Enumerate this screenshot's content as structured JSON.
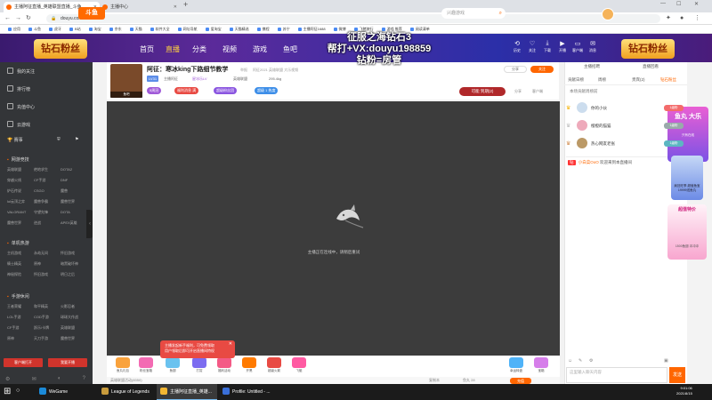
{
  "browser": {
    "tabs": [
      {
        "label": "主播阿征直播_英雄联盟直播_斗鱼..."
      },
      {
        "label": "主播中心"
      }
    ],
    "url": "douyu.com/198859",
    "bookmarks": [
      "应用",
      "斗鱼",
      "虎牙",
      "B站",
      "淘宝",
      "京东",
      "天猫",
      "软件大全",
      "网址导航",
      "爱淘宝",
      "天猫精选",
      "携程",
      "苏宁",
      "主播阿征1688",
      "微博",
      "飞猪旅行",
      "游戏 推荐",
      "阅读清单"
    ]
  },
  "header": {
    "left_badge": "钻石粉丝",
    "logo": "斗鱼",
    "nav": [
      "首页",
      "直播",
      "分类",
      "视频",
      "游戏",
      "鱼吧"
    ],
    "active_nav": "直播",
    "search_placeholder": "兴趣游戏",
    "icons": [
      {
        "name": "history-icon",
        "label": "历史"
      },
      {
        "name": "follow-icon",
        "label": "关注"
      },
      {
        "name": "download-icon",
        "label": "下载"
      },
      {
        "name": "live-icon",
        "label": "开播"
      },
      {
        "name": "client-icon",
        "label": "客户端"
      },
      {
        "name": "message-icon",
        "label": "消息"
      }
    ],
    "right_badge": "钻石粉丝"
  },
  "overlay": {
    "line1": "征服之海钻石3",
    "line2": "帮打+VX:douyu198859",
    "line3": "钻粉=房管"
  },
  "sidebar": {
    "nav": [
      "我的关注",
      "排行榜",
      "充值中心",
      "云游戏"
    ],
    "icons_label": "赛事",
    "sections": [
      {
        "title": "网游竞技",
        "items": [
          "英雄联盟",
          "绝地求生",
          "DOTA2",
          "穿越火线",
          "CF手游",
          "DNF",
          "炉石传说",
          "CSGO",
          "魔兽",
          "lol云顶之弈",
          "魔兽争霸",
          "魔兽世界",
          "VALORANT",
          "守望先锋",
          "DOTA",
          "魔兽世界",
          "逆战",
          "APEX英雄"
        ]
      },
      {
        "title": "单机热游",
        "items": [
          "主机游戏",
          "永劫无间",
          "怀旧游戏",
          "騎士精英",
          "原神",
          "暗黑破坏神",
          "神秘探险",
          "怀旧游戏",
          "明日之后"
        ]
      },
      {
        "title": "手游休闲",
        "items": [
          "王者荣耀",
          "和平精英",
          "火影忍者",
          "LOL手游",
          "COD手游",
          "球球大作战",
          "CF手游",
          "跃乐/卡牌",
          "英雄联盟",
          "原神",
          "天刀手游",
          "魔兽世界"
        ]
      }
    ],
    "btn_open": "客户端打开",
    "btn_live": "我要开播"
  },
  "room": {
    "avatar_label": "鱼吧",
    "title": "阿征：寒冰king下路细节教学",
    "category": "英雄联盟",
    "meta": [
      "举报",
      "阿征2021 英雄联盟 大乐视频"
    ],
    "level": "LV31",
    "line2_items": [
      "主播阿征",
      "星冰乐LV",
      "英雄联盟",
      "295.4kg"
    ],
    "pills": [
      {
        "label": "5周冠",
        "color": "#a05ad8"
      },
      {
        "label": "福利消息 满",
        "color": "#e84a43"
      },
      {
        "label": "超级粉丝团",
        "color": "#8a55e0"
      },
      {
        "label": "超级 1 热度",
        "color": "#3d8ee8"
      }
    ],
    "share_label": "分享",
    "follow_label": "关注",
    "gift_badge": "可能 到期(2)",
    "tools": [
      "分享",
      "客户端"
    ]
  },
  "player": {
    "message": "主播正在连线中，请稍后重试"
  },
  "gifts": [
    {
      "label": "鱼丸礼包",
      "color": "#f9a23c"
    },
    {
      "label": "粉丝宝箱",
      "color": "#f36bb3"
    },
    {
      "label": "鱼翅",
      "color": "#6ac2ef"
    },
    {
      "label": "打赏",
      "color": "#7c6cf0"
    },
    {
      "label": "福利活动",
      "color": "#f45a86"
    },
    {
      "label": "开黑",
      "color": "#ff7a00"
    },
    {
      "label": "超级火箭",
      "color": "#e84a43"
    },
    {
      "label": "飞艇",
      "color": "#ff5aa2"
    },
    {
      "label": "幸运转盘",
      "color": "#4fb3f8"
    },
    {
      "label": "宝箱",
      "color": "#d67eea"
    }
  ],
  "popup": {
    "line1": "主播发起新手福利，可免费领取",
    "line2": "用户领取后即可开启直播间特权"
  },
  "bottom": {
    "left": "英雄联盟活动(8350)",
    "mid": [
      "复制本",
      "鱼丸 28"
    ],
    "right_btn": "充值"
  },
  "right_panel": {
    "top_tabs": [
      "主播招聘",
      "直播回看"
    ],
    "tabs": [
      "贡献日榜",
      "周榜",
      "贵宾(2)",
      "钻石粉丝"
    ],
    "active_tab": "钻石粉丝",
    "rank_title": "本场贡献周榜前",
    "ranks": [
      {
        "crown": "♛",
        "crown_color": "#f5b000",
        "name": "你的小伙",
        "badge": "1级粉",
        "badge_color": "#f36b6b",
        "avatar": "#cde"
      },
      {
        "crown": "♛",
        "crown_color": "#bbb",
        "name": "橙橙的猫猫",
        "badge": "1级粉",
        "badge_color": "#9aa",
        "avatar": "#eab"
      },
      {
        "crown": "♛",
        "crown_color": "#d08a4a",
        "name": "热心网友老张",
        "badge": "1级粉",
        "badge_color": "#5cb6c2",
        "avatar": "#b96"
      }
    ],
    "chat": {
      "tag": "钻",
      "user": "小白菜OoO",
      "text": "欢迎来到本直播间"
    },
    "tools": [
      "☺",
      "✎",
      "⚙",
      "▣"
    ],
    "input_placeholder": "这里输入聊天内容",
    "send_label": "发送"
  },
  "ads": {
    "ad1_title": "鱼丸 大乐",
    "ad1_sub": "只有在线",
    "ad2_text": "疯狂旺季 超值鱼宝 19999送鱼丸",
    "ad3_title": "超值特价",
    "ad3_sub": "1500鱼翅 冲冲冲"
  },
  "taskbar": {
    "apps": [
      "WeGame",
      "League of Legends",
      "主播阿征直播_英雄...",
      "Profile: Untitled - ..."
    ],
    "time": "9:01:06",
    "date": "2021/8/15"
  }
}
